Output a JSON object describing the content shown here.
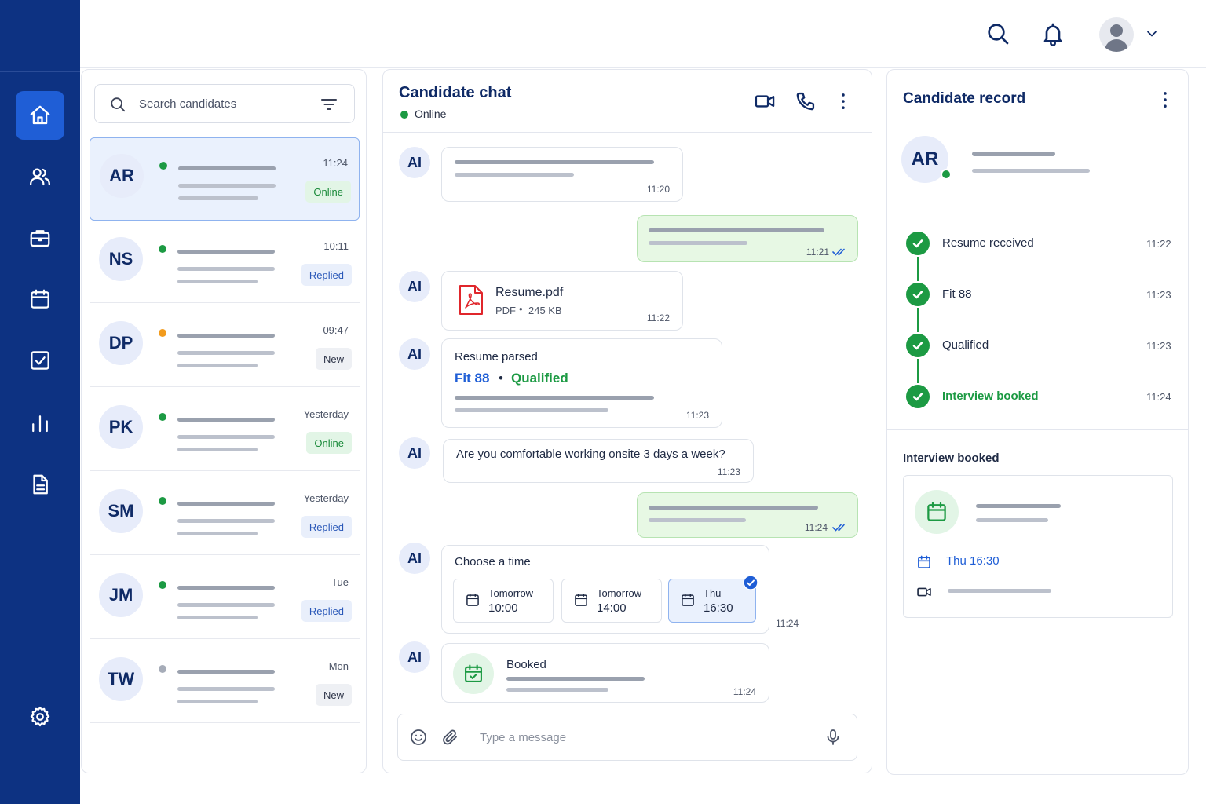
{
  "sidebar": {
    "items": [
      {
        "name": "home",
        "icon": "home-icon",
        "active": true
      },
      {
        "name": "candidates",
        "icon": "users-icon"
      },
      {
        "name": "jobs",
        "icon": "briefcase-icon"
      },
      {
        "name": "calendar",
        "icon": "calendar-icon"
      },
      {
        "name": "tasks",
        "icon": "checkbox-icon"
      },
      {
        "name": "analytics",
        "icon": "bar-chart-icon"
      },
      {
        "name": "documents",
        "icon": "document-icon"
      }
    ],
    "settings_icon": "gear-icon"
  },
  "search": {
    "placeholder": "Search candidates"
  },
  "candidates": [
    {
      "initials": "AR",
      "time": "11:24",
      "tag": "Online",
      "tag_type": "online",
      "status_color": "#1c9a43"
    },
    {
      "initials": "NS",
      "time": "10:11",
      "tag": "Replied",
      "tag_type": "replied",
      "status_color": "#1c9a43"
    },
    {
      "initials": "DP",
      "time": "09:47",
      "tag": "New",
      "tag_type": "new",
      "status_color": "#f29b1d"
    },
    {
      "initials": "PK",
      "time": "Yesterday",
      "tag": "Online",
      "tag_type": "online",
      "status_color": "#1c9a43"
    },
    {
      "initials": "SM",
      "time": "Yesterday",
      "tag": "Replied",
      "tag_type": "replied",
      "status_color": "#1c9a43"
    },
    {
      "initials": "JM",
      "time": "Tue",
      "tag": "Replied",
      "tag_type": "replied",
      "status_color": "#1c9a43"
    },
    {
      "initials": "TW",
      "time": "Mon",
      "tag": "New",
      "tag_type": "new",
      "status_color": "#a6acb8"
    }
  ],
  "chat": {
    "title": "Candidate chat",
    "status": "Online",
    "ai_label": "AI",
    "messages": {
      "m1_time": "11:20",
      "m2_time": "11:21",
      "file_name": "Resume.pdf",
      "file_type": "PDF",
      "file_size": "245 KB",
      "m3_time": "11:22",
      "parsed_title": "Resume parsed",
      "fit": "Fit 88",
      "qualified": "Qualified",
      "m4_time": "11:23",
      "question": "Are you comfortable working onsite 3 days a week?",
      "m5_time": "11:23",
      "m6_time": "11:24",
      "choose_title": "Choose a time",
      "slots": [
        {
          "day": "Tomorrow",
          "time": "10:00"
        },
        {
          "day": "Tomorrow",
          "time": "14:00"
        },
        {
          "day": "Thu",
          "time": "16:30",
          "selected": true
        }
      ],
      "m7_time": "11:24",
      "booked": "Booked",
      "m8_time": "11:24"
    },
    "input_placeholder": "Type a message"
  },
  "record": {
    "title": "Candidate record",
    "initials": "AR",
    "steps": [
      {
        "label": "Resume received",
        "time": "11:22"
      },
      {
        "label": "Fit 88",
        "time": "11:23"
      },
      {
        "label": "Qualified",
        "time": "11:23"
      },
      {
        "label": "Interview booked",
        "time": "11:24",
        "highlight": true
      }
    ],
    "interview": {
      "heading": "Interview booked",
      "when": "Thu 16:30"
    }
  },
  "colors": {
    "sidebar": "#0d3282",
    "accent": "#1f5ed6",
    "success": "#1c9a43",
    "link": "#1f5ed6"
  }
}
